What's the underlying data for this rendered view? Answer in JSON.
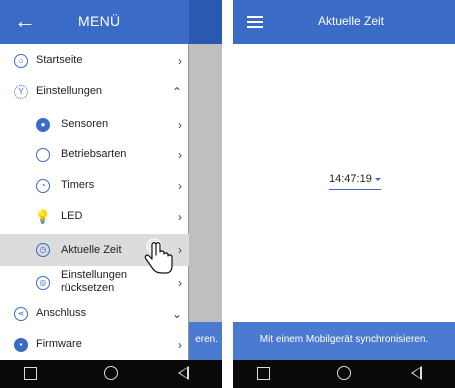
{
  "colors": {
    "primary": "#3a6bc6",
    "footer": "#4a7bd0",
    "selected_bg": "#dcdcdc",
    "navbar": "#0a0a0a"
  },
  "left_screen": {
    "header": {
      "back_icon": "arrow-left-icon",
      "title": "MENÜ"
    },
    "background_footer_text": "eren.",
    "menu_items": [
      {
        "id": "startseite",
        "label": "Startseite",
        "icon": "home-icon",
        "chevron": "›",
        "level": "top"
      },
      {
        "id": "einstellungen",
        "label": "Einstellungen",
        "icon": "settings-icon",
        "chevron": "⌃",
        "level": "top",
        "expanded": true
      },
      {
        "id": "sensoren",
        "label": "Sensoren",
        "icon": "sensor-icon",
        "chevron": "›",
        "level": "sub"
      },
      {
        "id": "betriebsarten",
        "label": "Betriebsarten",
        "icon": "mode-circle-icon",
        "chevron": "›",
        "level": "sub"
      },
      {
        "id": "timers",
        "label": "Timers",
        "icon": "timer-icon",
        "chevron": "›",
        "level": "sub"
      },
      {
        "id": "led",
        "label": "LED",
        "icon": "bulb-icon",
        "chevron": "›",
        "level": "sub"
      },
      {
        "id": "aktuelle-zeit",
        "label": "Aktuelle Zeit",
        "icon": "clock-icon",
        "chevron": "›",
        "level": "sub",
        "selected": true
      },
      {
        "id": "einstellungen-zuruecksetzen",
        "label_line1": "Einstellungen",
        "label_line2": "rücksetzen",
        "icon": "reset-icon",
        "chevron": "›",
        "level": "sub"
      },
      {
        "id": "anschluss",
        "label": "Anschluss",
        "icon": "share-icon",
        "chevron": "⌄",
        "level": "top"
      },
      {
        "id": "firmware",
        "label": "Firmware",
        "icon": "chip-icon",
        "chevron": "›",
        "level": "top"
      }
    ]
  },
  "right_screen": {
    "header": {
      "menu_icon": "hamburger-icon",
      "title": "Aktuelle Zeit"
    },
    "time_value": "14:47:19",
    "footer_text": "Mit einem Mobilgerät synchronisieren."
  },
  "navbar": {
    "items": [
      "square-icon",
      "circle-icon",
      "back-triangle-icon"
    ]
  }
}
